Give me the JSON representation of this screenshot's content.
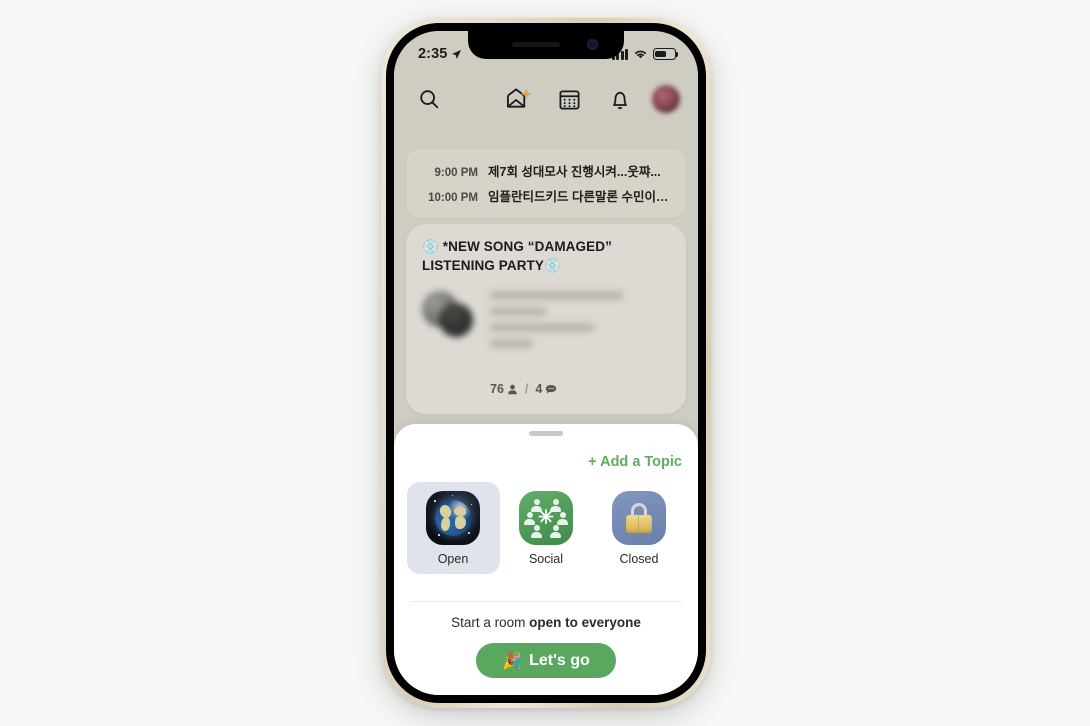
{
  "status_bar": {
    "time": "2:35",
    "location_arrow": "➤",
    "battery_level": "60%"
  },
  "nav": {
    "search_icon": "search-icon",
    "invites_icon": "envelope-sparkle-icon",
    "calendar_icon": "calendar-icon",
    "notifications_icon": "bell-icon",
    "avatar": "profile-avatar"
  },
  "upcoming_events": [
    {
      "time": "9:00 PM",
      "title": "제7회 성대모사 진행시켜...웃쨔..."
    },
    {
      "time": "10:00 PM",
      "title": "임플란티드키드 다른말론 수민이라는..."
    }
  ],
  "room_card": {
    "title_prefix_emoji": "💿",
    "title": "*NEW SONG “DAMAGED” LISTENING PARTY",
    "title_suffix_emoji": "💿",
    "speaker_count": "76",
    "speaker_icon": "person-icon",
    "separator": "/",
    "message_count": "4",
    "message_icon": "speech-bubble-icon",
    "participants_blurred": true
  },
  "sheet": {
    "handle": "drag-handle",
    "add_topic_label": "+ Add a Topic",
    "accent_green": "#5cae63",
    "room_types": [
      {
        "id": "open",
        "label": "Open",
        "icon": "globe-icon",
        "selected": true
      },
      {
        "id": "social",
        "label": "Social",
        "icon": "people-group-icon",
        "selected": false
      },
      {
        "id": "closed",
        "label": "Closed",
        "icon": "lock-icon",
        "selected": false
      }
    ],
    "cta_caption_prefix": "Start a room ",
    "cta_caption_emphasis": "open to everyone",
    "cta_emoji": "🎉",
    "cta_label": "Let's go",
    "cta_color": "#5aa860"
  },
  "theme": {
    "page_background": "#f7f7f5",
    "app_background": "#cfccc2",
    "events_card_background": "#d6d3c9",
    "room_card_background": "#dcdad2",
    "sheet_background": "#ffffff",
    "selected_option_background": "#dfe3ec"
  }
}
